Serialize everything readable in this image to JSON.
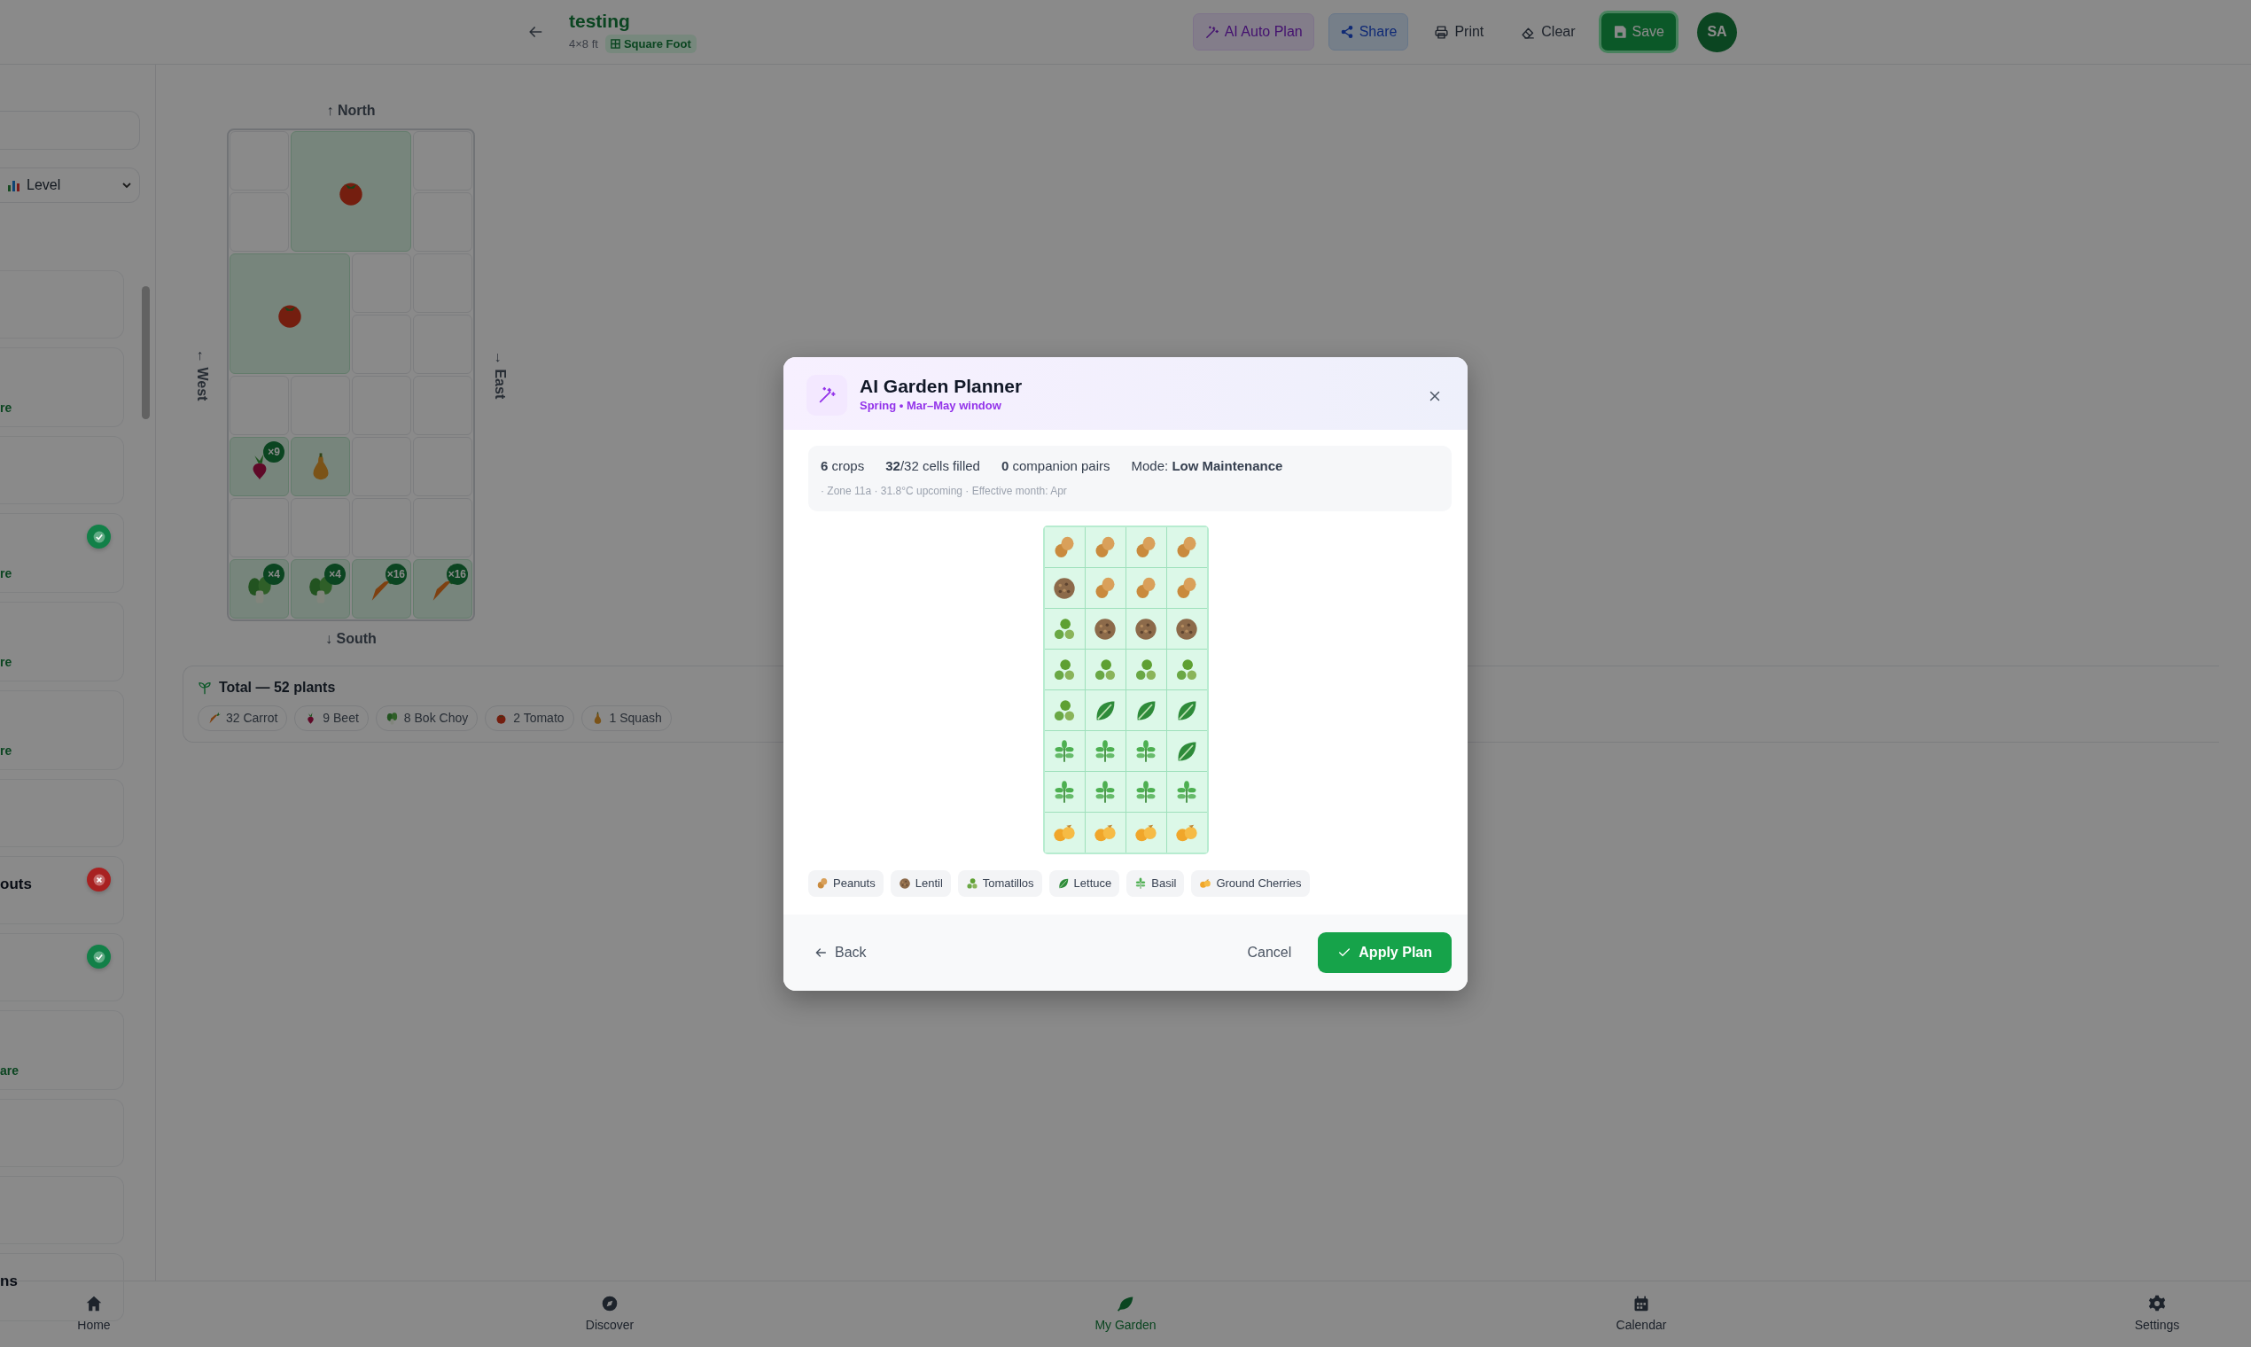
{
  "header": {
    "title": "testing",
    "size": "4×8 ft",
    "layout_badge": "Square Foot",
    "avatar": "SA",
    "buttons": [
      {
        "label": "AI Auto Plan",
        "kind": "ai"
      },
      {
        "label": "Share",
        "kind": "share"
      },
      {
        "label": "Print",
        "kind": "print"
      },
      {
        "label": "Clear",
        "kind": "clear"
      },
      {
        "label": "Save",
        "kind": "save"
      }
    ]
  },
  "sidebar": {
    "filter": {
      "value": "Level"
    },
    "cards": [
      {
        "kind": "plain"
      },
      {
        "kind": "link",
        "text": "re"
      },
      {
        "kind": "plain"
      },
      {
        "kind": "link",
        "text": "re",
        "color": "#128048"
      },
      {
        "kind": "link",
        "text": "re"
      },
      {
        "kind": "link",
        "text": "re"
      },
      {
        "kind": "plain"
      },
      {
        "kind": "title",
        "text": "outs",
        "color": "#a82121"
      },
      {
        "kind": "plain",
        "color": "#128048"
      },
      {
        "kind": "link",
        "text": "are"
      },
      {
        "kind": "plain"
      },
      {
        "kind": "plain"
      },
      {
        "kind": "title",
        "text": "ns"
      }
    ]
  },
  "garden": {
    "north": "↑ North",
    "south": "↓ South",
    "west": "← West",
    "east": "→ East",
    "rows": [
      [
        {
          "kind": "empty"
        },
        {
          "kind": "tomato",
          "large": true
        },
        {
          "kind": "covered"
        },
        {
          "kind": "empty"
        }
      ],
      [
        {
          "kind": "empty"
        },
        {
          "kind": "covered"
        },
        {
          "kind": "covered"
        },
        {
          "kind": "empty"
        }
      ],
      [
        {
          "kind": "tomato",
          "large": true
        },
        {
          "kind": "covered"
        },
        {
          "kind": "empty"
        },
        {
          "kind": "empty"
        }
      ],
      [
        {
          "kind": "covered"
        },
        {
          "kind": "covered"
        },
        {
          "kind": "empty"
        },
        {
          "kind": "empty"
        }
      ],
      [
        {
          "kind": "empty"
        },
        {
          "kind": "empty"
        },
        {
          "kind": "empty"
        },
        {
          "kind": "empty"
        }
      ],
      [
        {
          "kind": "beet",
          "count": "×9"
        },
        {
          "kind": "squash"
        },
        {
          "kind": "empty"
        },
        {
          "kind": "empty"
        }
      ],
      [
        {
          "kind": "empty"
        },
        {
          "kind": "empty"
        },
        {
          "kind": "empty"
        },
        {
          "kind": "empty"
        }
      ],
      [
        {
          "kind": "bokchoy",
          "count": "×4"
        },
        {
          "kind": "bokchoy",
          "count": "×4"
        },
        {
          "kind": "carrot",
          "count": "×16"
        },
        {
          "kind": "carrot",
          "count": "×16"
        }
      ]
    ]
  },
  "total": {
    "title": "Total — 52 plants",
    "chips": [
      {
        "kind": "carrot",
        "label": "32 Carrot"
      },
      {
        "kind": "beet",
        "label": "9 Beet"
      },
      {
        "kind": "bokchoy",
        "label": "8 Bok Choy"
      },
      {
        "kind": "tomato",
        "label": "2 Tomato"
      },
      {
        "kind": "squash",
        "label": "1 Squash"
      }
    ]
  },
  "modal": {
    "title": "AI Garden Planner",
    "subtitle": "Spring • Mar–May window",
    "stats": [
      "**6** crops",
      "**32**/32 cells filled",
      "**0** companion pairs",
      "Mode: **Low Maintenance**"
    ],
    "note": "· Zone 11a · 31.8°C upcoming · Effective month: Apr",
    "grid": [
      [
        {
          "kind": "peanut"
        },
        {
          "kind": "peanut"
        },
        {
          "kind": "peanut"
        },
        {
          "kind": "peanut"
        }
      ],
      [
        {
          "kind": "lentil"
        },
        {
          "kind": "peanut"
        },
        {
          "kind": "peanut"
        },
        {
          "kind": "peanut"
        }
      ],
      [
        {
          "kind": "tomatillo"
        },
        {
          "kind": "lentil"
        },
        {
          "kind": "lentil"
        },
        {
          "kind": "lentil"
        }
      ],
      [
        {
          "kind": "tomatillo"
        },
        {
          "kind": "tomatillo"
        },
        {
          "kind": "tomatillo"
        },
        {
          "kind": "tomatillo"
        }
      ],
      [
        {
          "kind": "tomatillo"
        },
        {
          "kind": "lettuce"
        },
        {
          "kind": "lettuce"
        },
        {
          "kind": "lettuce"
        }
      ],
      [
        {
          "kind": "basil"
        },
        {
          "kind": "basil"
        },
        {
          "kind": "basil"
        },
        {
          "kind": "lettuce"
        }
      ],
      [
        {
          "kind": "basil"
        },
        {
          "kind": "basil"
        },
        {
          "kind": "basil"
        },
        {
          "kind": "basil"
        }
      ],
      [
        {
          "kind": "groundcherry"
        },
        {
          "kind": "groundcherry"
        },
        {
          "kind": "groundcherry"
        },
        {
          "kind": "groundcherry"
        }
      ]
    ],
    "legend": [
      {
        "kind": "peanut",
        "label": "Peanuts"
      },
      {
        "kind": "lentil",
        "label": "Lentil"
      },
      {
        "kind": "tomatillo",
        "label": "Tomatillos"
      },
      {
        "kind": "lettuce",
        "label": "Lettuce"
      },
      {
        "kind": "basil",
        "label": "Basil"
      },
      {
        "kind": "groundcherry",
        "label": "Ground Cherries"
      }
    ],
    "back": "Back",
    "cancel": "Cancel",
    "apply": "Apply Plan"
  },
  "nav": [
    {
      "label": "Home",
      "kind": "home",
      "selected": false
    },
    {
      "label": "Discover",
      "kind": "discover",
      "selected": false
    },
    {
      "label": "My Garden",
      "kind": "garden",
      "selected": true
    },
    {
      "label": "Calendar",
      "kind": "calendar",
      "selected": false
    },
    {
      "label": "Settings",
      "kind": "settings",
      "selected": false
    }
  ]
}
